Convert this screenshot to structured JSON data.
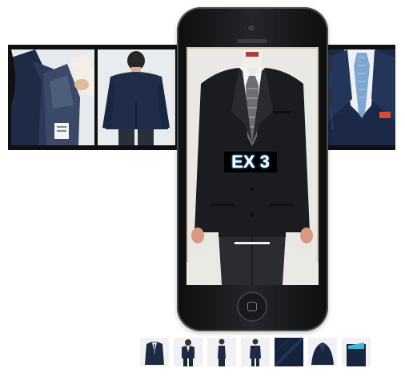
{
  "product": {
    "label": "EX 3"
  },
  "colors": {
    "navy": "#1d2a44",
    "charcoal": "#1b1b1e",
    "label_glow": "#49a7ff",
    "screen_bg": "#ddd6c3"
  },
  "gallery": {
    "side_images": [
      "jacket-lining-icon",
      "jacket-back-icon",
      "shirt-tie-closeup-icon"
    ],
    "main_image": "suit-front-icon",
    "thumbnails": [
      "suit-front-thumb-icon",
      "suit-mannequin-thumb-icon",
      "suit-side-thumb-icon",
      "suit-side-2-thumb-icon",
      "fabric-swatch-thumb-icon",
      "jacket-folded-thumb-icon",
      "pocket-square-thumb-icon"
    ]
  }
}
